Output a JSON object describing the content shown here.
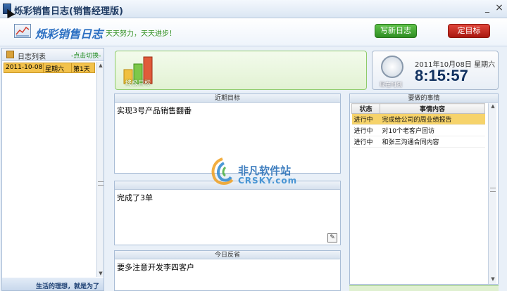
{
  "window": {
    "title": "烁彩销售日志(销售经理版)",
    "minimize": "_",
    "close": "×"
  },
  "brand": {
    "name": "烁彩销售日志",
    "slogan": "天天努力，天天进步！"
  },
  "toolbar": {
    "write_label": "写新日志",
    "goal_label": "定目标"
  },
  "sidebar": {
    "title": "日志列表",
    "switch": "-点击切换-",
    "rows": [
      {
        "date": "2011-10-08",
        "weekday": "星期六",
        "day": "第1天"
      }
    ],
    "footer_tip": "生活的理想，就是为了"
  },
  "final_goal": {
    "label": "终极目标"
  },
  "clock": {
    "label": "现在时刻",
    "date": "2011年10月08日 星期六",
    "time": "8:15:57"
  },
  "recent_goals": {
    "title": "近期目标",
    "text": "实现3号产品销售翻番"
  },
  "done": {
    "text": "完成了3单"
  },
  "reflect": {
    "title": "今日反省",
    "text": "要多注意开发李四客户"
  },
  "todo": {
    "title": "要做的事情",
    "columns": [
      "状态",
      "事情内容"
    ],
    "rows": [
      {
        "status": "进行中",
        "content": "完成给公司的周业绩报告"
      },
      {
        "status": "进行中",
        "content": "对10个老客户回访"
      },
      {
        "status": "进行中",
        "content": "和张三沟通合同内容"
      }
    ]
  },
  "watermark": {
    "cn": "非凡软件站",
    "en": "CRSKY.com"
  }
}
